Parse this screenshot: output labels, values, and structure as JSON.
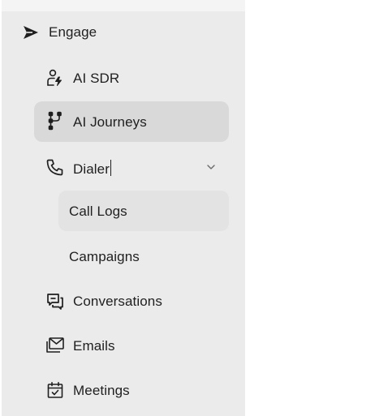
{
  "sidebar": {
    "section_header": {
      "label": "Engage",
      "icon": "send-arrow-icon"
    },
    "items": [
      {
        "label": "AI SDR",
        "icon": "user-bolt-icon",
        "active": false
      },
      {
        "label": "AI Journeys",
        "icon": "journey-nodes-icon",
        "active": true
      },
      {
        "label": "Dialer",
        "icon": "phone-icon",
        "expanded": true,
        "chevron": "chevron-down-icon"
      },
      {
        "label": "Conversations",
        "icon": "chat-bubbles-icon",
        "active": false
      },
      {
        "label": "Emails",
        "icon": "mail-stack-icon",
        "active": false
      },
      {
        "label": "Meetings",
        "icon": "calendar-check-icon",
        "active": false
      }
    ],
    "dialer_subitems": [
      {
        "label": "Call Logs",
        "active": true
      },
      {
        "label": "Campaigns",
        "active": false
      }
    ]
  },
  "colors": {
    "sidebar_bg": "#ebebeb",
    "active_bg": "#d9d9d9",
    "sub_active_bg": "#e3e3e3",
    "text": "#1f1f1f"
  }
}
